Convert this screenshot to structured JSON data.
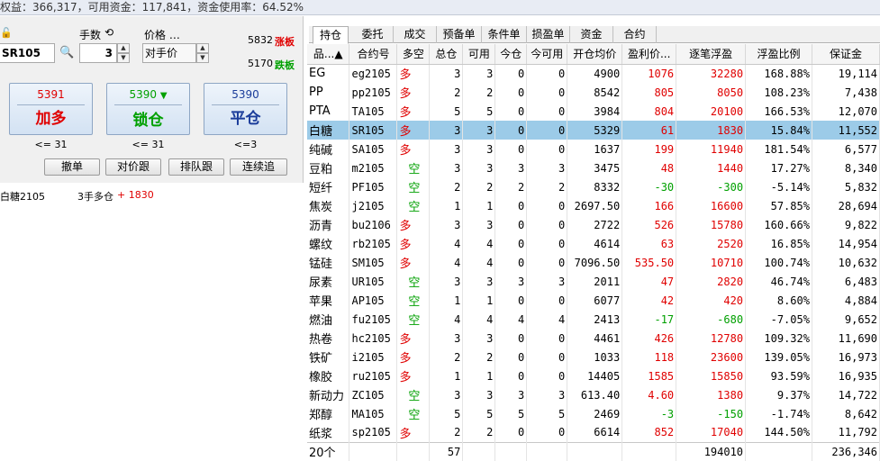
{
  "account": {
    "summary": "权益：366,317，可用资金：117,841，资金使用率：64.52%"
  },
  "order_form": {
    "lock_icon": "lock-icon",
    "qty_label": "手数",
    "qty_icon": "refresh-icon",
    "price_label": "价格 …",
    "symbol": "SR105",
    "qty": "3",
    "price_mode": "对手价",
    "limit_up_value": "5832",
    "limit_up_label": "涨板",
    "limit_down_value": "5170",
    "limit_down_label": "跌板",
    "buttons": [
      {
        "price": "5391",
        "action": "加多",
        "limit": "<= 31"
      },
      {
        "price": "5390",
        "action": "锁仓",
        "limit": "<= 31",
        "arrow": "▼"
      },
      {
        "price": "5390",
        "action": "平仓",
        "limit": "<=3"
      }
    ],
    "small_buttons": [
      "撤单",
      "对价跟",
      "排队跟",
      "连续追"
    ],
    "position_line": {
      "name": "白糖2105",
      "desc": "3手多仓",
      "pnl": "+ 1830"
    }
  },
  "tabs": [
    "持仓",
    "委托",
    "成交",
    "预备单",
    "条件单",
    "损盈单",
    "资金",
    "合约"
  ],
  "active_tab": 0,
  "table": {
    "headers": [
      "品...▲",
      "合约号",
      "多空",
      "总仓",
      "可用",
      "今仓",
      "今可用",
      "开仓均价",
      "盈利价...",
      "逐笔浮盈",
      "浮盈比例",
      "保证金"
    ],
    "rows": [
      [
        "EG",
        "eg2105",
        "多",
        "3",
        "3",
        "0",
        "0",
        "4900",
        "1076",
        "32280",
        "168.88%",
        "19,114"
      ],
      [
        "PP",
        "pp2105",
        "多",
        "2",
        "2",
        "0",
        "0",
        "8542",
        "805",
        "8050",
        "108.23%",
        "7,438"
      ],
      [
        "PTA",
        "TA105",
        "多",
        "5",
        "5",
        "0",
        "0",
        "3984",
        "804",
        "20100",
        "166.53%",
        "12,070"
      ],
      [
        "白糖",
        "SR105",
        "多",
        "3",
        "3",
        "0",
        "0",
        "5329",
        "61",
        "1830",
        "15.84%",
        "11,552"
      ],
      [
        "纯碱",
        "SA105",
        "多",
        "3",
        "3",
        "0",
        "0",
        "1637",
        "199",
        "11940",
        "181.54%",
        "6,577"
      ],
      [
        "豆粕",
        "m2105",
        "空",
        "3",
        "3",
        "3",
        "3",
        "3475",
        "48",
        "1440",
        "17.27%",
        "8,340"
      ],
      [
        "短纤",
        "PF105",
        "空",
        "2",
        "2",
        "2",
        "2",
        "8332",
        "-30",
        "-300",
        "-5.14%",
        "5,832"
      ],
      [
        "焦炭",
        "j2105",
        "空",
        "1",
        "1",
        "0",
        "0",
        "2697.50",
        "166",
        "16600",
        "57.85%",
        "28,694"
      ],
      [
        "沥青",
        "bu2106",
        "多",
        "3",
        "3",
        "0",
        "0",
        "2722",
        "526",
        "15780",
        "160.66%",
        "9,822"
      ],
      [
        "螺纹",
        "rb2105",
        "多",
        "4",
        "4",
        "0",
        "0",
        "4614",
        "63",
        "2520",
        "16.85%",
        "14,954"
      ],
      [
        "锰硅",
        "SM105",
        "多",
        "4",
        "4",
        "0",
        "0",
        "7096.50",
        "535.50",
        "10710",
        "100.74%",
        "10,632"
      ],
      [
        "尿素",
        "UR105",
        "空",
        "3",
        "3",
        "3",
        "3",
        "2011",
        "47",
        "2820",
        "46.74%",
        "6,483"
      ],
      [
        "苹果",
        "AP105",
        "空",
        "1",
        "1",
        "0",
        "0",
        "6077",
        "42",
        "420",
        "8.60%",
        "4,884"
      ],
      [
        "燃油",
        "fu2105",
        "空",
        "4",
        "4",
        "4",
        "4",
        "2413",
        "-17",
        "-680",
        "-7.05%",
        "9,652"
      ],
      [
        "热卷",
        "hc2105",
        "多",
        "3",
        "3",
        "0",
        "0",
        "4461",
        "426",
        "12780",
        "109.32%",
        "11,690"
      ],
      [
        "铁矿",
        "i2105",
        "多",
        "2",
        "2",
        "0",
        "0",
        "1033",
        "118",
        "23600",
        "139.05%",
        "16,973"
      ],
      [
        "橡胶",
        "ru2105",
        "多",
        "1",
        "1",
        "0",
        "0",
        "14405",
        "1585",
        "15850",
        "93.59%",
        "16,935"
      ],
      [
        "新动力",
        "ZC105",
        "空",
        "3",
        "3",
        "3",
        "3",
        "613.40",
        "4.60",
        "1380",
        "9.37%",
        "14,722"
      ],
      [
        "郑醇",
        "MA105",
        "空",
        "5",
        "5",
        "5",
        "5",
        "2469",
        "-3",
        "-150",
        "-1.74%",
        "8,642"
      ],
      [
        "纸浆",
        "sp2105",
        "多",
        "2",
        "2",
        "0",
        "0",
        "6614",
        "852",
        "17040",
        "144.50%",
        "11,792"
      ]
    ],
    "selected_row": 3,
    "footer": {
      "count": "20个",
      "total_qty": "57",
      "total_pnl": "194010",
      "total_margin": "236,346"
    }
  },
  "colors": {
    "long": "#e00000",
    "short": "#00a000",
    "selected": "#9ccbe8"
  }
}
